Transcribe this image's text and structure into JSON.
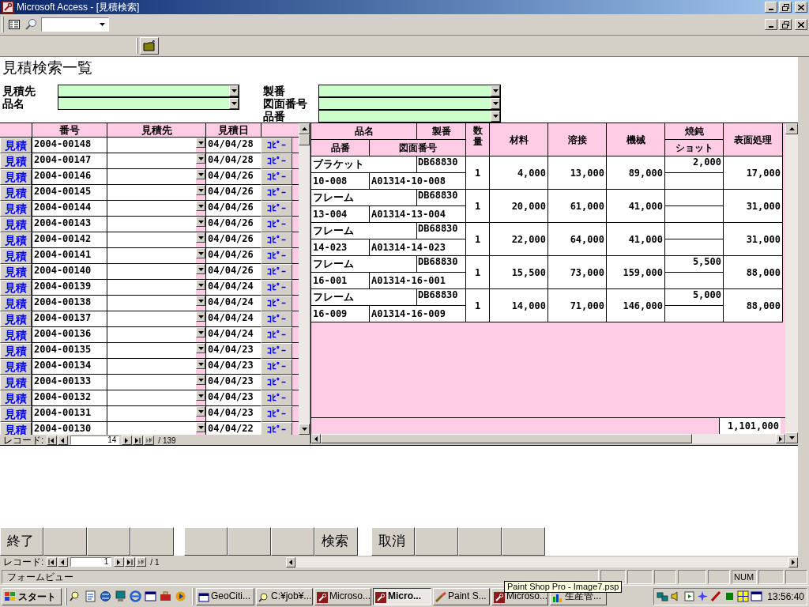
{
  "window": {
    "title": "Microsoft Access - [見積検索]"
  },
  "form": {
    "title": "見積検索一覧",
    "filters_left": [
      {
        "label": "見積先"
      },
      {
        "label": "品名"
      }
    ],
    "filters_right": [
      {
        "label": "製番"
      },
      {
        "label": "図面番号"
      },
      {
        "label": "品番"
      }
    ]
  },
  "estimate_list": {
    "columns": [
      "番号",
      "見積先",
      "見積日"
    ],
    "rows": [
      {
        "button": "見積",
        "number": "2004-00148",
        "date": "04/04/28",
        "copy": "ｺﾋﾟｰ"
      },
      {
        "button": "見積",
        "number": "2004-00147",
        "date": "04/04/28",
        "copy": "ｺﾋﾟｰ"
      },
      {
        "button": "見積",
        "number": "2004-00146",
        "date": "04/04/26",
        "copy": "ｺﾋﾟｰ"
      },
      {
        "button": "見積",
        "number": "2004-00145",
        "date": "04/04/26",
        "copy": "ｺﾋﾟｰ"
      },
      {
        "button": "見積",
        "number": "2004-00144",
        "date": "04/04/26",
        "copy": "ｺﾋﾟｰ"
      },
      {
        "button": "見積",
        "number": "2004-00143",
        "date": "04/04/26",
        "copy": "ｺﾋﾟｰ"
      },
      {
        "button": "見積",
        "number": "2004-00142",
        "date": "04/04/26",
        "copy": "ｺﾋﾟｰ"
      },
      {
        "button": "見積",
        "number": "2004-00141",
        "date": "04/04/26",
        "copy": "ｺﾋﾟｰ"
      },
      {
        "button": "見積",
        "number": "2004-00140",
        "date": "04/04/26",
        "copy": "ｺﾋﾟｰ"
      },
      {
        "button": "見積",
        "number": "2004-00139",
        "date": "04/04/24",
        "copy": "ｺﾋﾟｰ"
      },
      {
        "button": "見積",
        "number": "2004-00138",
        "date": "04/04/24",
        "copy": "ｺﾋﾟｰ"
      },
      {
        "button": "見積",
        "number": "2004-00137",
        "date": "04/04/24",
        "copy": "ｺﾋﾟｰ"
      },
      {
        "button": "見積",
        "number": "2004-00136",
        "date": "04/04/24",
        "copy": "ｺﾋﾟｰ"
      },
      {
        "button": "見積",
        "number": "2004-00135",
        "date": "04/04/23",
        "copy": "ｺﾋﾟｰ"
      },
      {
        "button": "見積",
        "number": "2004-00134",
        "date": "04/04/23",
        "copy": "ｺﾋﾟｰ"
      },
      {
        "button": "見積",
        "number": "2004-00133",
        "date": "04/04/23",
        "copy": "ｺﾋﾟｰ"
      },
      {
        "button": "見積",
        "number": "2004-00132",
        "date": "04/04/23",
        "copy": "ｺﾋﾟｰ"
      },
      {
        "button": "見積",
        "number": "2004-00131",
        "date": "04/04/23",
        "copy": "ｺﾋﾟｰ"
      },
      {
        "button": "見積",
        "number": "2004-00130",
        "date": "04/04/22",
        "copy": "ｺﾋﾟｰ"
      }
    ],
    "record_nav": {
      "label": "レコード:",
      "current": "14",
      "total": "/ 139"
    }
  },
  "estimate_detail": {
    "headers": {
      "name": "品名",
      "seiban": "製番",
      "quantity": "数量",
      "material": "材料",
      "welding": "溶接",
      "machining": "機械",
      "annealing": "焼鈍",
      "surface": "表面処理",
      "part_no": "品番",
      "drawing_no": "図面番号",
      "shot": "ショット"
    },
    "rows": [
      {
        "name": "ブラケット",
        "seiban": "DB68830",
        "quantity": "1",
        "material": "4,000",
        "welding": "13,000",
        "machining": "89,000",
        "annealing": "2,000",
        "surface": "17,000",
        "part_no": "10-008",
        "drawing_no": "A01314-10-008"
      },
      {
        "name": "フレーム",
        "seiban": "DB68830",
        "quantity": "1",
        "material": "20,000",
        "welding": "61,000",
        "machining": "41,000",
        "surface": "31,000",
        "part_no": "13-004",
        "drawing_no": "A01314-13-004"
      },
      {
        "name": "フレーム",
        "seiban": "DB68830",
        "quantity": "1",
        "material": "22,000",
        "welding": "64,000",
        "machining": "41,000",
        "surface": "31,000",
        "part_no": "14-023",
        "drawing_no": "A01314-14-023"
      },
      {
        "name": "フレーム",
        "seiban": "DB68830",
        "quantity": "1",
        "material": "15,500",
        "welding": "73,000",
        "machining": "159,000",
        "annealing": "5,500",
        "surface": "88,000",
        "part_no": "16-001",
        "drawing_no": "A01314-16-001"
      },
      {
        "name": "フレーム",
        "seiban": "DB68830",
        "quantity": "1",
        "material": "14,000",
        "welding": "71,000",
        "machining": "146,000",
        "annealing": "5,000",
        "surface": "88,000",
        "part_no": "16-009",
        "drawing_no": "A01314-16-009"
      }
    ],
    "total": "1,101,000"
  },
  "button_groups": [
    [
      {
        "kind": "text",
        "label": "終了"
      },
      {
        "kind": "blank"
      },
      {
        "kind": "blank"
      },
      {
        "kind": "blank"
      }
    ],
    [
      {
        "kind": "blank"
      },
      {
        "kind": "blank"
      },
      {
        "kind": "blank"
      },
      {
        "kind": "text",
        "label": "検索"
      }
    ],
    [
      {
        "kind": "text",
        "label": "取消"
      },
      {
        "kind": "blank"
      },
      {
        "kind": "blank"
      },
      {
        "kind": "blank"
      }
    ]
  ],
  "record_nav": {
    "label": "レコード:",
    "current": "1",
    "total": "/ 1"
  },
  "status_bar": {
    "text": "フォームビュー",
    "indicator": "NUM"
  },
  "taskbar": {
    "start": "スタート",
    "tasks": [
      {
        "label": "GeoCiti...",
        "selected": false,
        "kind": "window"
      },
      {
        "label": "C:¥job¥...",
        "selected": false,
        "kind": "search"
      },
      {
        "label": "Microso...",
        "selected": false,
        "kind": "key"
      },
      {
        "label": "Micro...",
        "selected": true,
        "kind": "key"
      },
      {
        "label": "Paint S...",
        "selected": false,
        "kind": "brush"
      },
      {
        "label": "Microso...",
        "selected": false,
        "kind": "key"
      },
      {
        "label": "生産管...",
        "selected": false,
        "kind": "chart"
      }
    ],
    "clock": "13:56:40"
  },
  "tooltip": "Paint Shop Pro - Image7.psp"
}
